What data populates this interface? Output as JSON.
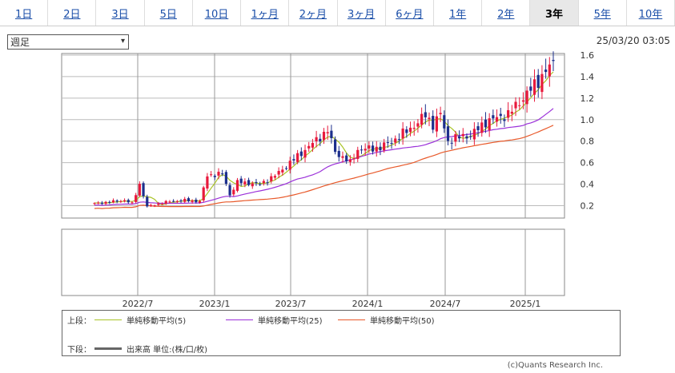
{
  "tabs": [
    {
      "label": "1日",
      "active": false
    },
    {
      "label": "2日",
      "active": false
    },
    {
      "label": "3日",
      "active": false
    },
    {
      "label": "5日",
      "active": false
    },
    {
      "label": "10日",
      "active": false
    },
    {
      "label": "1ヶ月",
      "active": false
    },
    {
      "label": "2ヶ月",
      "active": false
    },
    {
      "label": "3ヶ月",
      "active": false
    },
    {
      "label": "6ヶ月",
      "active": false
    },
    {
      "label": "1年",
      "active": false
    },
    {
      "label": "2年",
      "active": false
    },
    {
      "label": "3年",
      "active": true
    },
    {
      "label": "5年",
      "active": false
    },
    {
      "label": "10年",
      "active": false
    }
  ],
  "period_select": {
    "value": "週足"
  },
  "timestamp": "25/03/20 03:05",
  "legend": {
    "upper_label": "上段：",
    "lower_label": "下段：",
    "ma5": "単純移動平均(5)",
    "ma25": "単純移動平均(25)",
    "ma50": "単純移動平均(50)",
    "volume": "出来高 単位:(株/口/枚)"
  },
  "copyright": "(c)Quants Research Inc.",
  "colors": {
    "up": "#e8193c",
    "down": "#1c2f8c",
    "ma5": "#a9c326",
    "ma25": "#9b30d9",
    "ma50": "#e8592a",
    "grid": "#999999"
  },
  "chart_data": {
    "type": "candlestick",
    "y_ticks": [
      "1.6",
      "1.4",
      "1.2",
      "1.0",
      "0.8",
      "0.6",
      "0.4",
      "0.2"
    ],
    "ylim": [
      0.1,
      1.6
    ],
    "x_ticks": [
      "2022/7",
      "2023/1",
      "2023/7",
      "2024/1",
      "2024/7",
      "2025/1"
    ],
    "close_anchors": [
      [
        0,
        0.22
      ],
      [
        8,
        0.25
      ],
      [
        10,
        0.22
      ],
      [
        12,
        0.4
      ],
      [
        14,
        0.19
      ],
      [
        16,
        0.21
      ],
      [
        20,
        0.24
      ],
      [
        24,
        0.25
      ],
      [
        28,
        0.24
      ],
      [
        30,
        0.48
      ],
      [
        34,
        0.5
      ],
      [
        36,
        0.3
      ],
      [
        38,
        0.42
      ],
      [
        44,
        0.4
      ],
      [
        48,
        0.48
      ],
      [
        52,
        0.6
      ],
      [
        58,
        0.78
      ],
      [
        62,
        0.9
      ],
      [
        64,
        0.7
      ],
      [
        68,
        0.6
      ],
      [
        70,
        0.72
      ],
      [
        76,
        0.74
      ],
      [
        80,
        0.82
      ],
      [
        86,
        0.97
      ],
      [
        88,
        1.05
      ],
      [
        90,
        0.95
      ],
      [
        92,
        1.05
      ],
      [
        94,
        0.8
      ],
      [
        98,
        0.85
      ],
      [
        100,
        0.85
      ],
      [
        104,
        0.98
      ],
      [
        110,
        1.05
      ],
      [
        116,
        1.28
      ],
      [
        120,
        1.45
      ],
      [
        122,
        1.52
      ]
    ],
    "series": [
      {
        "name": "単純移動平均(5)",
        "period": 5
      },
      {
        "name": "単純移動平均(25)",
        "period": 25
      },
      {
        "name": "単純移動平均(50)",
        "period": 50
      }
    ]
  }
}
